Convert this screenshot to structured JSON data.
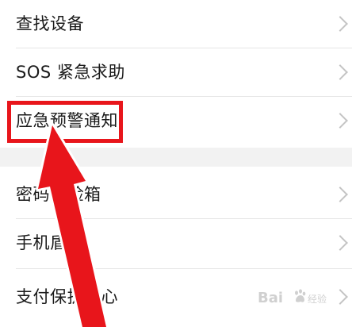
{
  "settings_group_1": {
    "items": [
      {
        "label": "查找设备"
      },
      {
        "label": "SOS 紧急求助"
      },
      {
        "label": "应急预警通知"
      }
    ]
  },
  "settings_group_2": {
    "items": [
      {
        "label": "密码保险箱"
      },
      {
        "label": "手机盾"
      },
      {
        "label": "支付保护中心"
      }
    ]
  },
  "annotation": {
    "highlight_color": "#e8151b",
    "arrow_color": "#e8151b"
  },
  "watermark": {
    "brand": "Bai",
    "brand_suffix": "经验",
    "icon": "baidu-paw-icon"
  }
}
